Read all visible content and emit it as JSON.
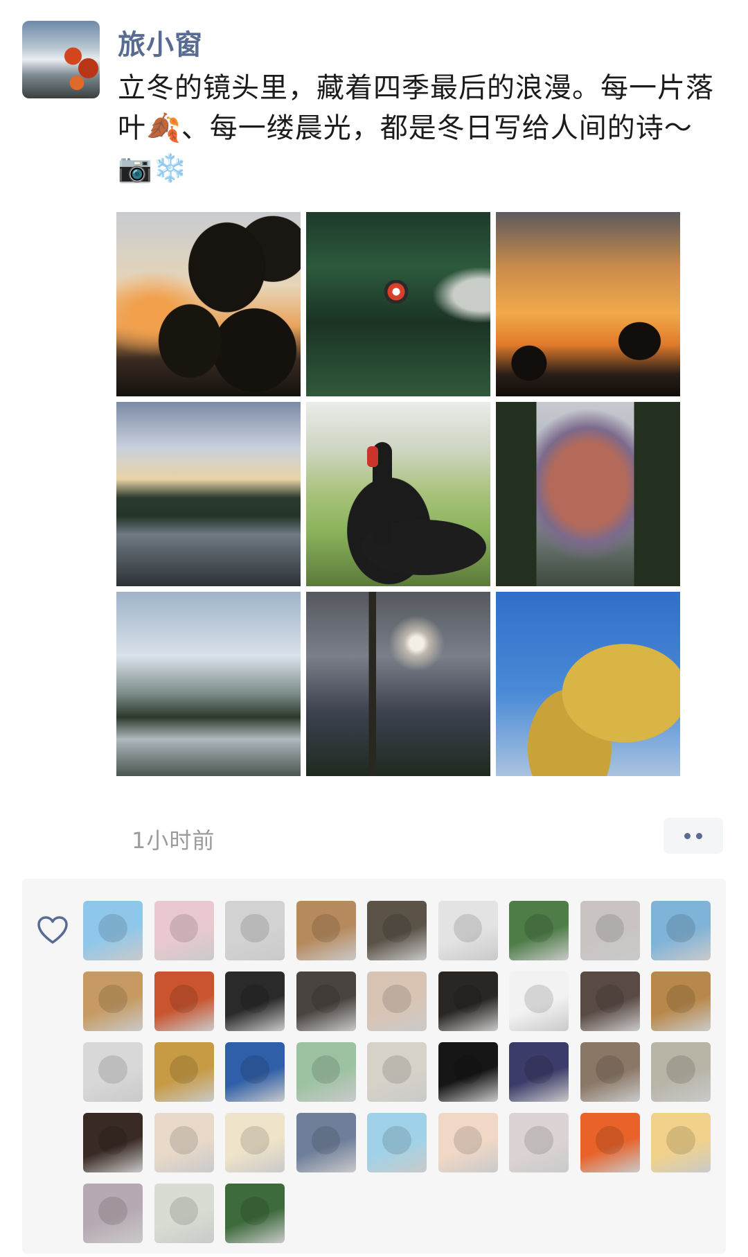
{
  "post": {
    "author": "旅小窗",
    "text": "立冬的镜头里，藏着四季最后的浪漫。每一片落叶🍂、每一缕晨光，都是冬日写给人间的诗～📷❄️",
    "photos": [
      {
        "scene": "sunset-tree-silhouette"
      },
      {
        "scene": "butterfly-over-green-water"
      },
      {
        "scene": "orange-sunset-sky"
      },
      {
        "scene": "lake-at-dusk"
      },
      {
        "scene": "black-swan"
      },
      {
        "scene": "snow-mountain-framed-by-pines"
      },
      {
        "scene": "lake-with-hills"
      },
      {
        "scene": "moon-behind-clouds-and-tree"
      },
      {
        "scene": "golden-tree-blue-sky"
      }
    ],
    "timestamp": "1小时前"
  },
  "likes": {
    "icon": "heart-outline-icon",
    "avatars": [
      {
        "bg": "#8fc7ea"
      },
      {
        "bg": "#e9c9cf"
      },
      {
        "bg": "#d2d2d2"
      },
      {
        "bg": "#b78a5e"
      },
      {
        "bg": "#5b5348"
      },
      {
        "bg": "#e3e3e3"
      },
      {
        "bg": "#4e7d48"
      },
      {
        "bg": "#c9c4c2"
      },
      {
        "bg": "#7fb3d8"
      },
      {
        "bg": "#c69a62"
      },
      {
        "bg": "#c9542e"
      },
      {
        "bg": "#2a2a2a"
      },
      {
        "bg": "#4a4440"
      },
      {
        "bg": "#d9c4b4"
      },
      {
        "bg": "#2a2624"
      },
      {
        "bg": "#f2f2f2"
      },
      {
        "bg": "#5a4a44"
      },
      {
        "bg": "#b8884a"
      },
      {
        "bg": "#d8d8d8"
      },
      {
        "bg": "#c79a44"
      },
      {
        "bg": "#2f5fa8"
      },
      {
        "bg": "#9dc2a2"
      },
      {
        "bg": "#d6d2c8"
      },
      {
        "bg": "#161616"
      },
      {
        "bg": "#3c3c6a"
      },
      {
        "bg": "#8a7766"
      },
      {
        "bg": "#b8b4a6"
      },
      {
        "bg": "#3a2a24"
      },
      {
        "bg": "#e9d9c9"
      },
      {
        "bg": "#efe3c9"
      },
      {
        "bg": "#6f7f9a"
      },
      {
        "bg": "#9fd2e8"
      },
      {
        "bg": "#f1d8c6"
      },
      {
        "bg": "#dcd4d4"
      },
      {
        "bg": "#e8622a"
      },
      {
        "bg": "#f2d28a"
      },
      {
        "bg": "#b7a9b3"
      },
      {
        "bg": "#d7ddd2"
      },
      {
        "bg": "#3d6b3c"
      }
    ]
  }
}
